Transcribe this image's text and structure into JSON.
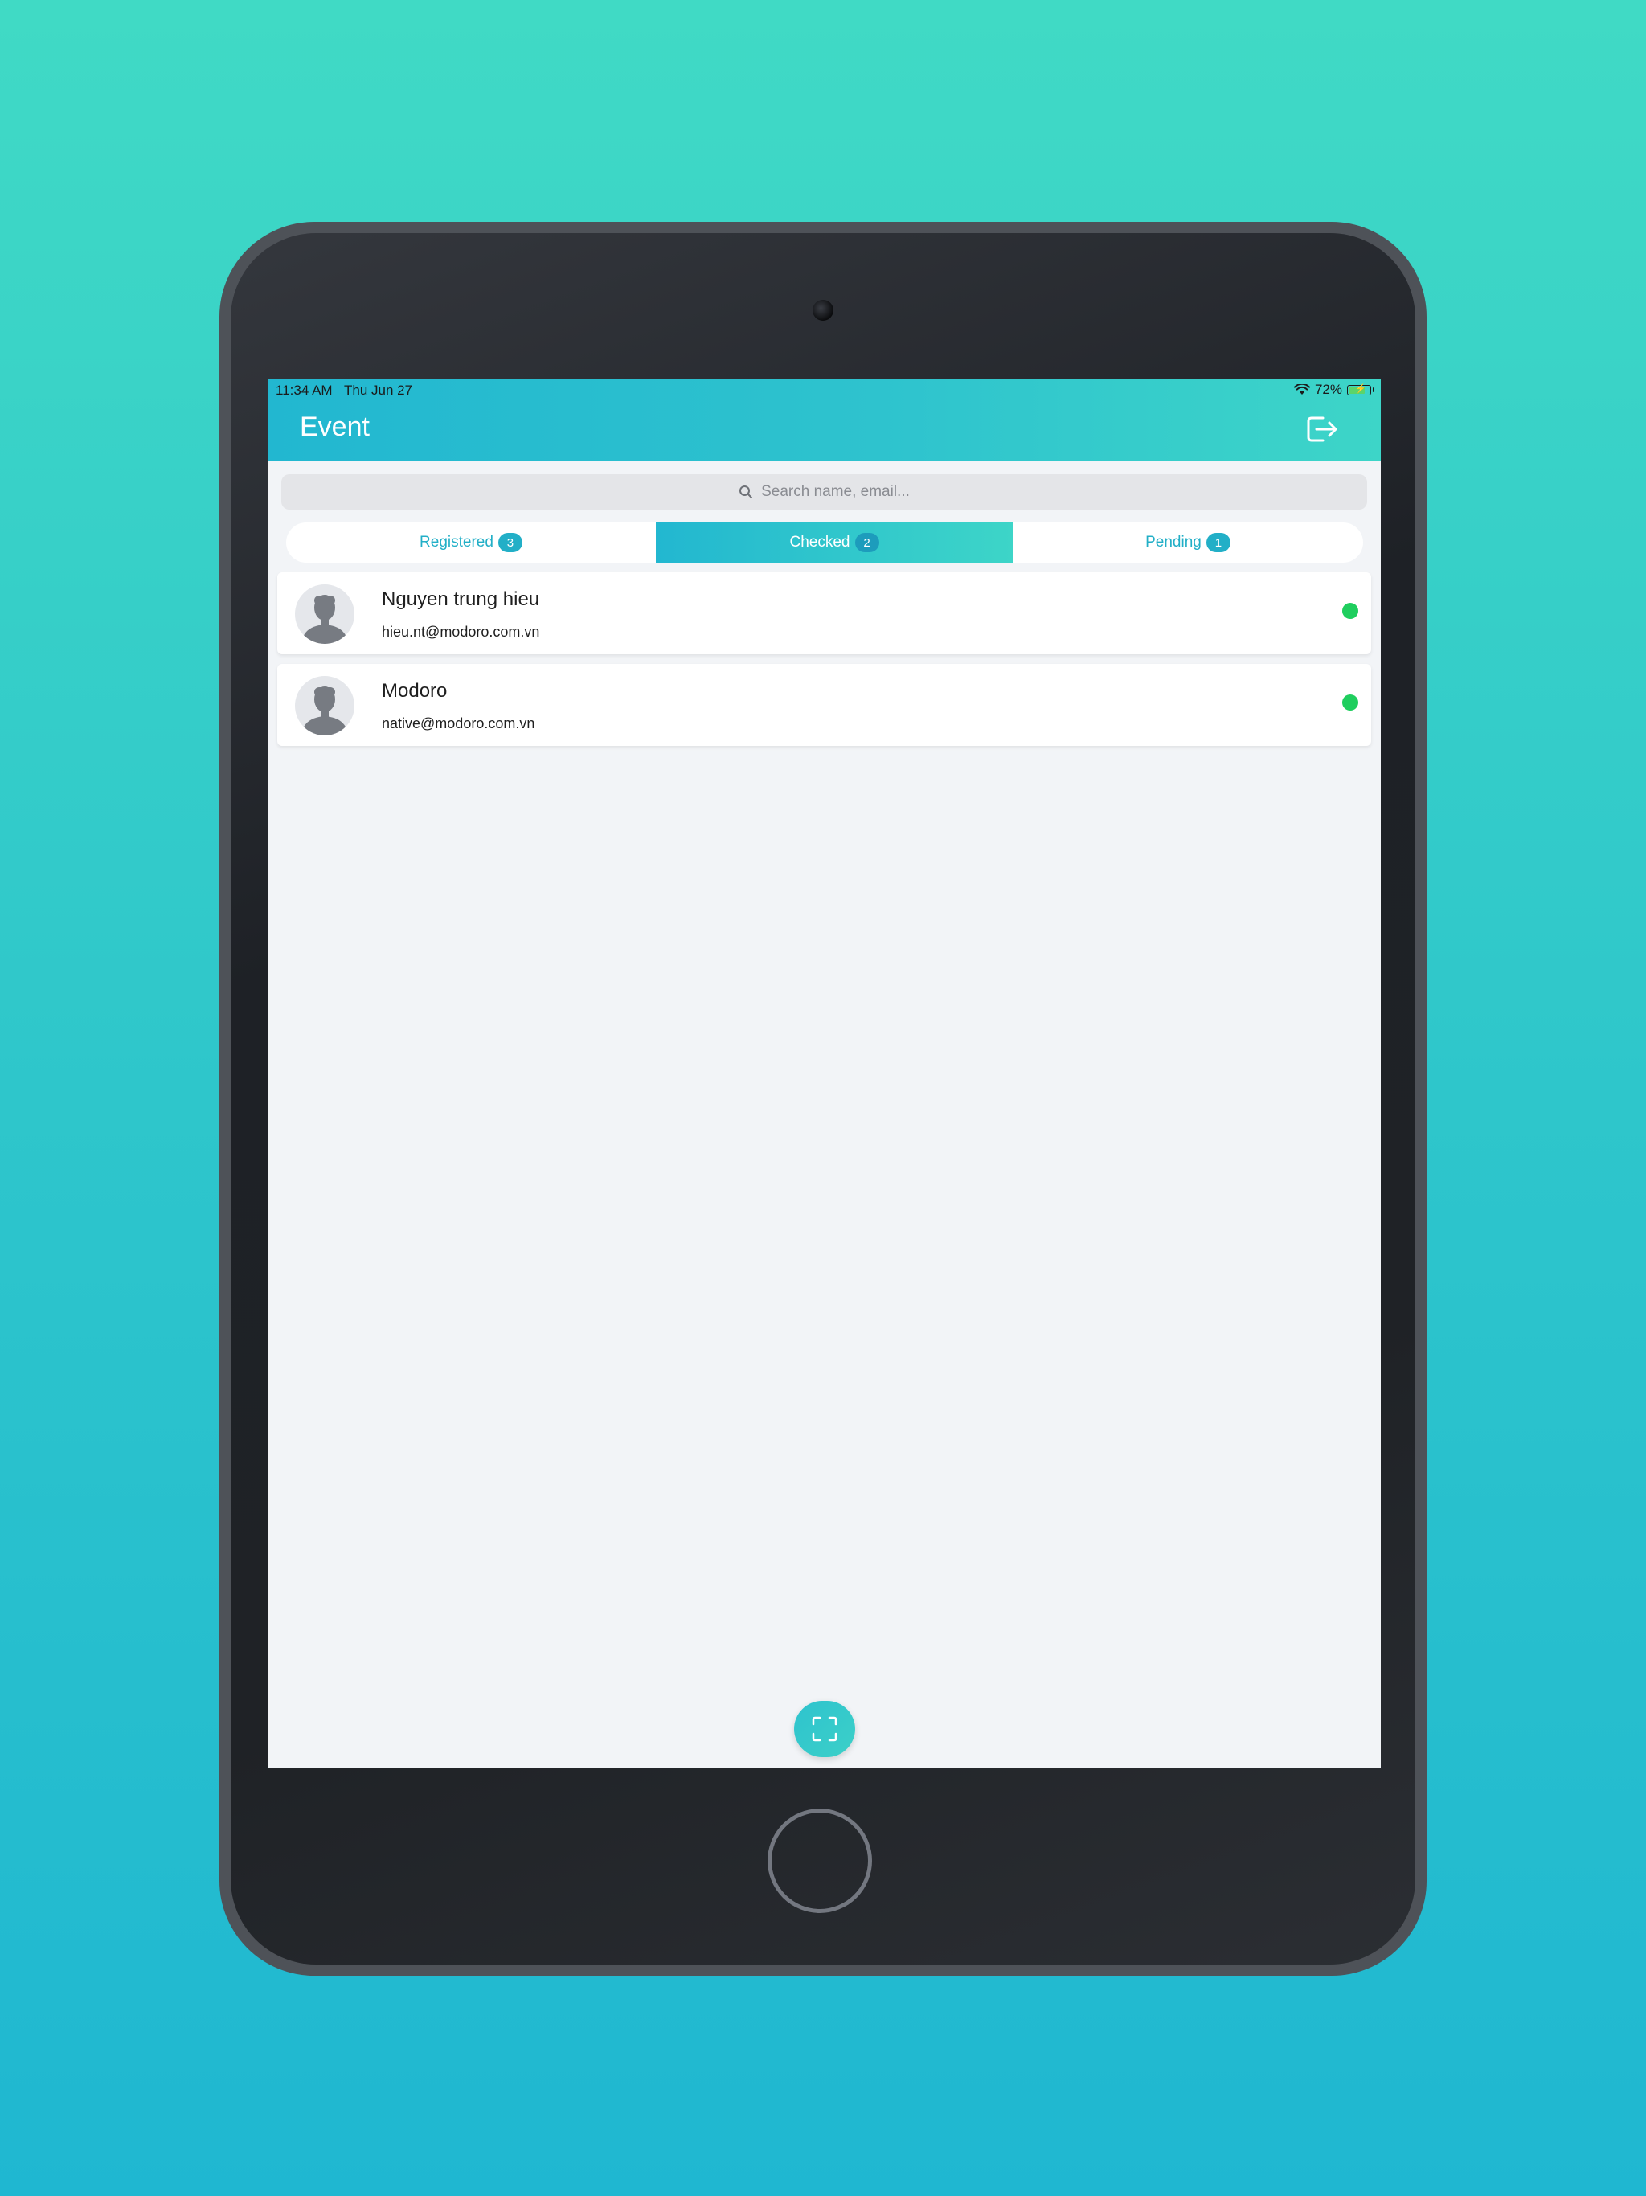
{
  "status_bar": {
    "time": "11:34 AM",
    "date": "Thu Jun 27",
    "battery": "72%",
    "icons": [
      "wifi-icon",
      "battery-icon"
    ]
  },
  "header": {
    "title": "Event",
    "logout_icon": "logout-icon"
  },
  "search": {
    "placeholder": "Search name, email...",
    "icon": "search-icon"
  },
  "tabs": [
    {
      "label": "Registered",
      "count": "3",
      "active": false
    },
    {
      "label": "Checked",
      "count": "2",
      "active": true
    },
    {
      "label": "Pending",
      "count": "1",
      "active": false
    }
  ],
  "attendees": [
    {
      "name": "Nguyen trung hieu",
      "email": "hieu.nt@modoro.com.vn",
      "status_color": "#1fce5e"
    },
    {
      "name": "Modoro",
      "email": "native@modoro.com.vn",
      "status_color": "#1fce5e"
    }
  ],
  "scan_button": {
    "icon": "scan-icon"
  },
  "colors": {
    "accent": "#22b7d0",
    "accent_end": "#3dd5c8",
    "status_green": "#1fce5e",
    "background": "#f2f4f7"
  }
}
